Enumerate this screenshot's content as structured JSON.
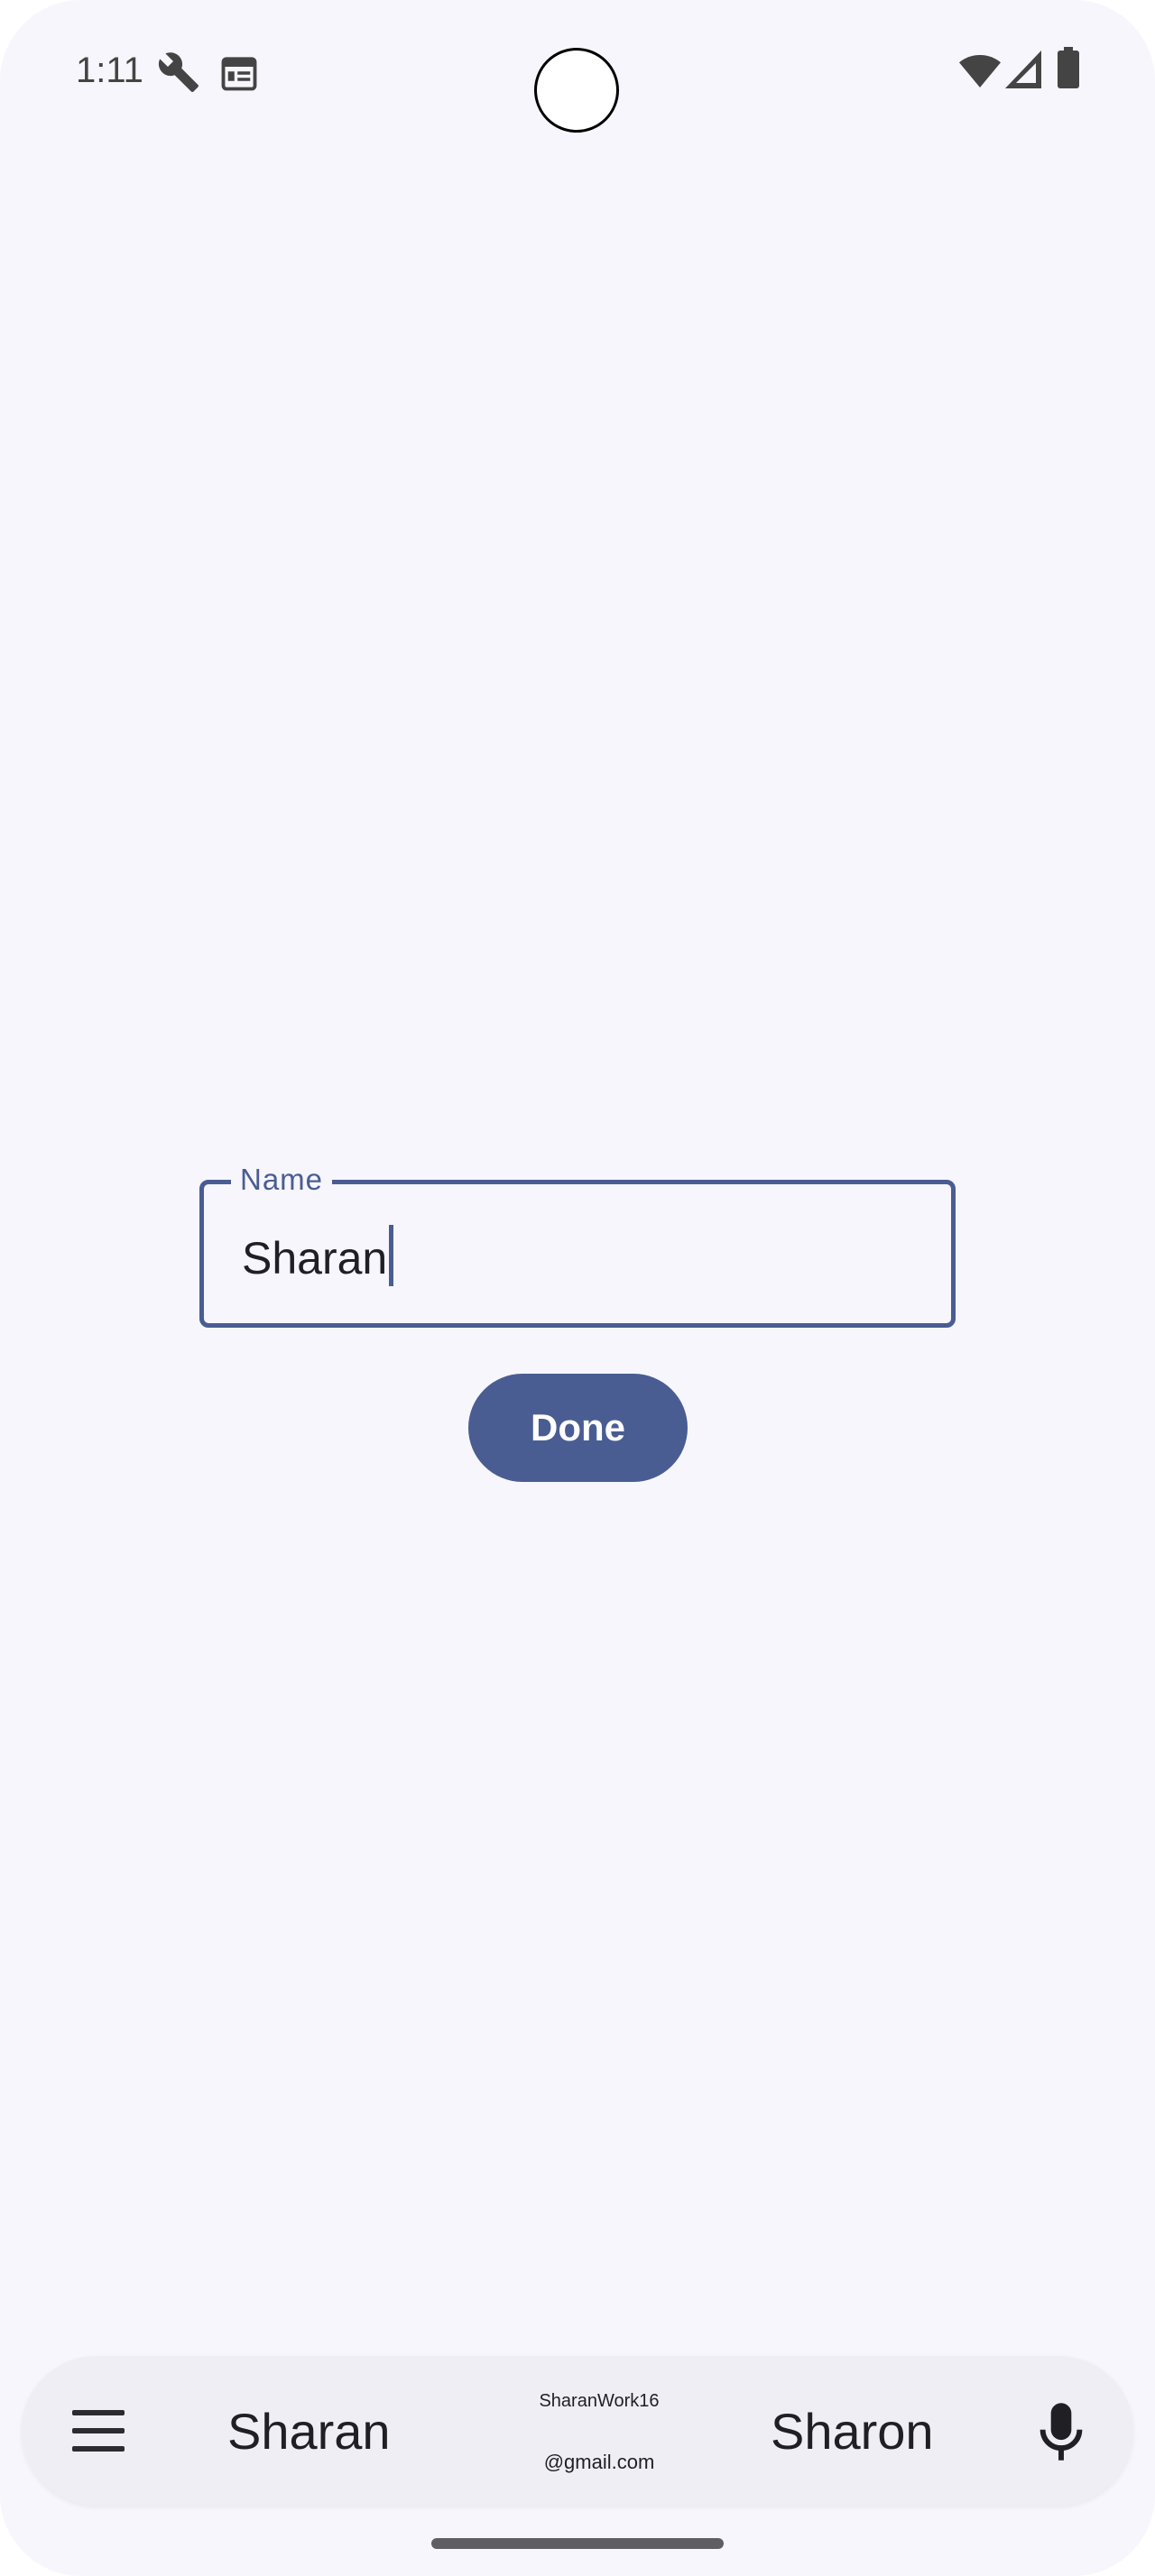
{
  "status_bar": {
    "time": "1:11",
    "icons": [
      "wrench-icon",
      "calendar-icon",
      "wifi-icon",
      "signal-icon",
      "battery-icon"
    ]
  },
  "form": {
    "field_label": "Name",
    "field_value": "Sharan",
    "done_label": "Done"
  },
  "keyboard": {
    "suggestions": [
      "Sharan",
      "Sharon"
    ],
    "email_suggestion": {
      "line1": "SharanWork16",
      "line2": "@gmail.com"
    }
  },
  "colors": {
    "accent": "#4a5d93",
    "background": "#f6f6fc",
    "text": "#1f1f24"
  }
}
